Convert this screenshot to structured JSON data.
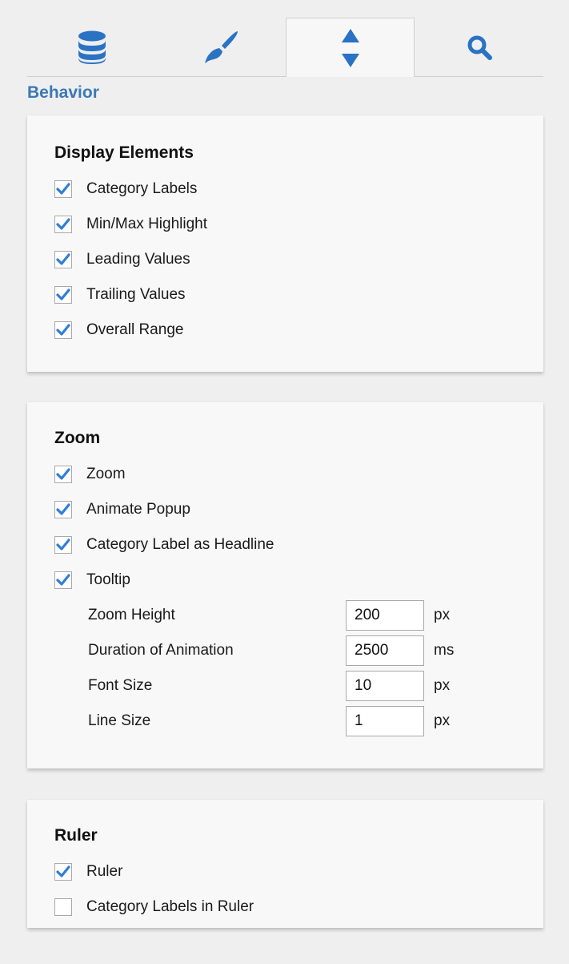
{
  "tabs": [
    {
      "icon": "database-icon",
      "active": false
    },
    {
      "icon": "brush-icon",
      "active": false
    },
    {
      "icon": "sort-arrows-icon",
      "active": true
    },
    {
      "icon": "search-icon",
      "active": false
    }
  ],
  "section_heading": "Behavior",
  "display_elements": {
    "title": "Display Elements",
    "items": [
      {
        "label": "Category Labels",
        "checked": true
      },
      {
        "label": "Min/Max Highlight",
        "checked": true
      },
      {
        "label": "Leading Values",
        "checked": true
      },
      {
        "label": "Trailing Values",
        "checked": true
      },
      {
        "label": "Overall Range",
        "checked": true
      }
    ]
  },
  "zoom": {
    "title": "Zoom",
    "items": [
      {
        "label": "Zoom",
        "checked": true
      },
      {
        "label": "Animate Popup",
        "checked": true
      },
      {
        "label": "Category Label as Headline",
        "checked": true
      },
      {
        "label": "Tooltip",
        "checked": true
      }
    ],
    "fields": [
      {
        "label": "Zoom Height",
        "value": "200",
        "unit": "px"
      },
      {
        "label": "Duration of Animation",
        "value": "2500",
        "unit": "ms"
      },
      {
        "label": "Font Size",
        "value": "10",
        "unit": "px"
      },
      {
        "label": "Line Size",
        "value": "1",
        "unit": "px"
      }
    ]
  },
  "ruler": {
    "title": "Ruler",
    "items": [
      {
        "label": "Ruler",
        "checked": true
      },
      {
        "label": "Category Labels in Ruler",
        "checked": false
      }
    ]
  },
  "colors": {
    "accent": "#2f7ed8",
    "heading": "#3b78b6",
    "icon": "#2a72c4"
  }
}
